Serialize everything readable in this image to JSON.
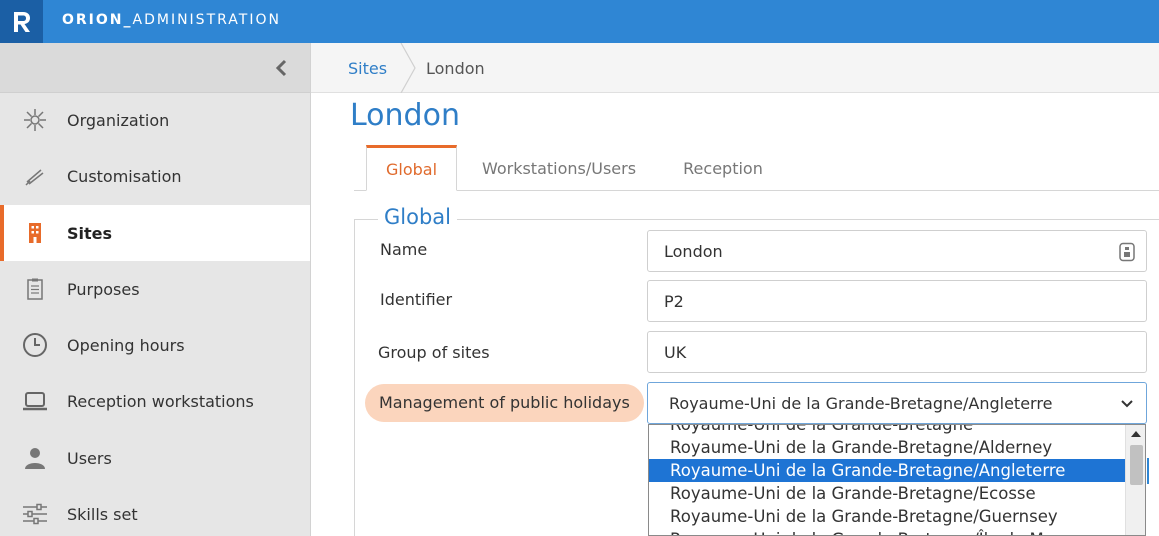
{
  "app": {
    "logo_letter": "R",
    "title_bold": "ORION_",
    "title_rest": "ADMINISTRATION"
  },
  "sidebar": {
    "collapse_icon": "chevron-left-icon",
    "items": [
      {
        "label": "Organization",
        "icon": "network-icon"
      },
      {
        "label": "Customisation",
        "icon": "brush-icon"
      },
      {
        "label": "Sites",
        "icon": "building-icon",
        "active": true
      },
      {
        "label": "Purposes",
        "icon": "clipboard-icon"
      },
      {
        "label": "Opening hours",
        "icon": "clock-icon"
      },
      {
        "label": "Reception workstations",
        "icon": "laptop-icon"
      },
      {
        "label": "Users",
        "icon": "user-icon"
      },
      {
        "label": "Skills set",
        "icon": "sliders-icon"
      }
    ]
  },
  "breadcrumb": {
    "items": [
      "Sites",
      "London"
    ]
  },
  "page": {
    "title": "London",
    "tabs": [
      {
        "label": "Global",
        "active": true
      },
      {
        "label": "Workstations/Users"
      },
      {
        "label": "Reception"
      }
    ],
    "section_title": "Global"
  },
  "form": {
    "name": {
      "label": "Name",
      "value": "London"
    },
    "identifier": {
      "label": "Identifier",
      "value": "P2"
    },
    "group": {
      "label": "Group of sites",
      "value": "UK"
    },
    "holidays": {
      "label": "Management of public holidays",
      "value": "Royaume-Uni de la Grande-Bretagne/Angleterre",
      "options": [
        "Royaume-Uni de la Grande-Bretagne",
        "Royaume-Uni de la Grande-Bretagne/Alderney",
        "Royaume-Uni de la Grande-Bretagne/Angleterre",
        "Royaume-Uni de la Grande-Bretagne/Ecosse",
        "Royaume-Uni de la Grande-Bretagne/Guernsey",
        "Royaume-Uni de la Grande-Bretagne/Île de Man"
      ],
      "selected_index": 2
    }
  },
  "colors": {
    "topbar": "#2f86d4",
    "accent": "#e86b2a",
    "link": "#2f7ec7",
    "highlight": "#fbd5bd",
    "selection": "#1e74d4"
  }
}
